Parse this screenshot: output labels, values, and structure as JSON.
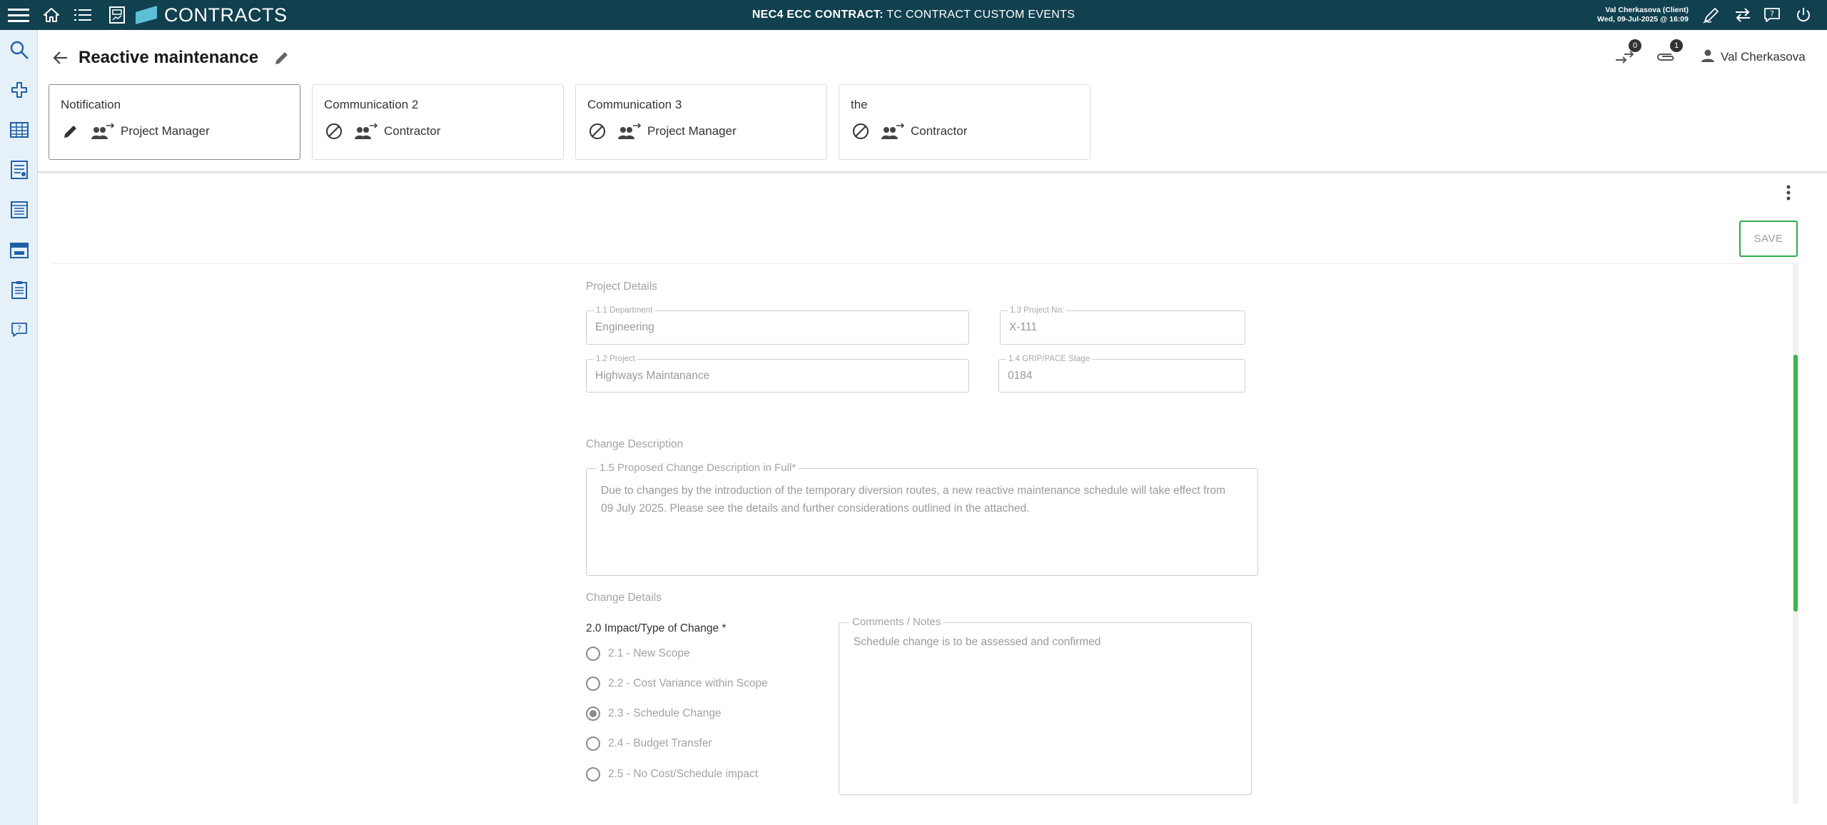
{
  "topbar": {
    "app_name": "CONTRACTS",
    "contract_prefix": "NEC4 ECC CONTRACT:",
    "contract_name": "TC CONTRACT CUSTOM EVENTS",
    "user_line": "Val Cherkasova (Client)",
    "date_line": "Wed, 09-Jul-2025 @ 16:09",
    "icons": [
      "menu-icon",
      "home-icon",
      "list-icon",
      "report-icon",
      "contracts-logo",
      "sign-icon",
      "swap-icon",
      "help-icon",
      "power-icon"
    ]
  },
  "leftrail": {
    "icons": [
      "search-icon",
      "add-icon",
      "grid-icon",
      "register-icon",
      "table-icon",
      "calendar-icon",
      "clipboard-icon",
      "feedback-icon"
    ]
  },
  "header": {
    "title": "Reactive maintenance",
    "links_count": "0",
    "attachments_count": "1",
    "user_name": "Val Cherkasova"
  },
  "steps": [
    {
      "name": "Notification",
      "status_icon": "edit-icon",
      "role": "Project Manager",
      "active": true
    },
    {
      "name": "Communication 2",
      "status_icon": "blocked-icon",
      "role": "Contractor",
      "active": false
    },
    {
      "name": "Communication 3",
      "status_icon": "blocked-icon",
      "role": "Project Manager",
      "active": false
    },
    {
      "name": "the",
      "status_icon": "blocked-icon",
      "role": "Contractor",
      "active": false
    }
  ],
  "toolbar": {
    "save_label": "SAVE"
  },
  "project_details": {
    "section_label": "Project Details",
    "department": {
      "label": "1.1 Department",
      "value": "Engineering"
    },
    "project_no": {
      "label": "1.3 Project No:",
      "value": "X-111"
    },
    "project": {
      "label": "1.2 Project",
      "value": "Highways Maintanance"
    },
    "grip_stage": {
      "label": "1.4 GRIP/PACE Stage",
      "value": "0184"
    }
  },
  "change_description": {
    "section_label": "Change Description",
    "field_label": "1.5 Proposed Change Description in Full*",
    "value": "Due to changes by the introduction of the temporary diversion routes, a new reactive maintenance schedule will take effect from 09 July 2025. Please see the details and further considerations outlined in the attached."
  },
  "change_details": {
    "section_label": "Change Details",
    "impact_title": "2.0 Impact/Type of Change *",
    "options": [
      {
        "label": "2.1 - New Scope",
        "checked": false
      },
      {
        "label": "2.2 - Cost Variance within Scope",
        "checked": false
      },
      {
        "label": "2.3 - Schedule Change",
        "checked": true
      },
      {
        "label": "2.4 - Budget Transfer",
        "checked": false
      },
      {
        "label": "2.5 - No Cost/Schedule impact",
        "checked": false
      }
    ],
    "comments_label": "Comments / Notes",
    "comments_value": "Schedule change is to be assessed and confirmed"
  },
  "colors": {
    "topbar_bg": "#11404f",
    "rail_bg": "#e6f0f9",
    "accent_green": "#2ea84d",
    "brand_teal": "#5bc0d6"
  }
}
